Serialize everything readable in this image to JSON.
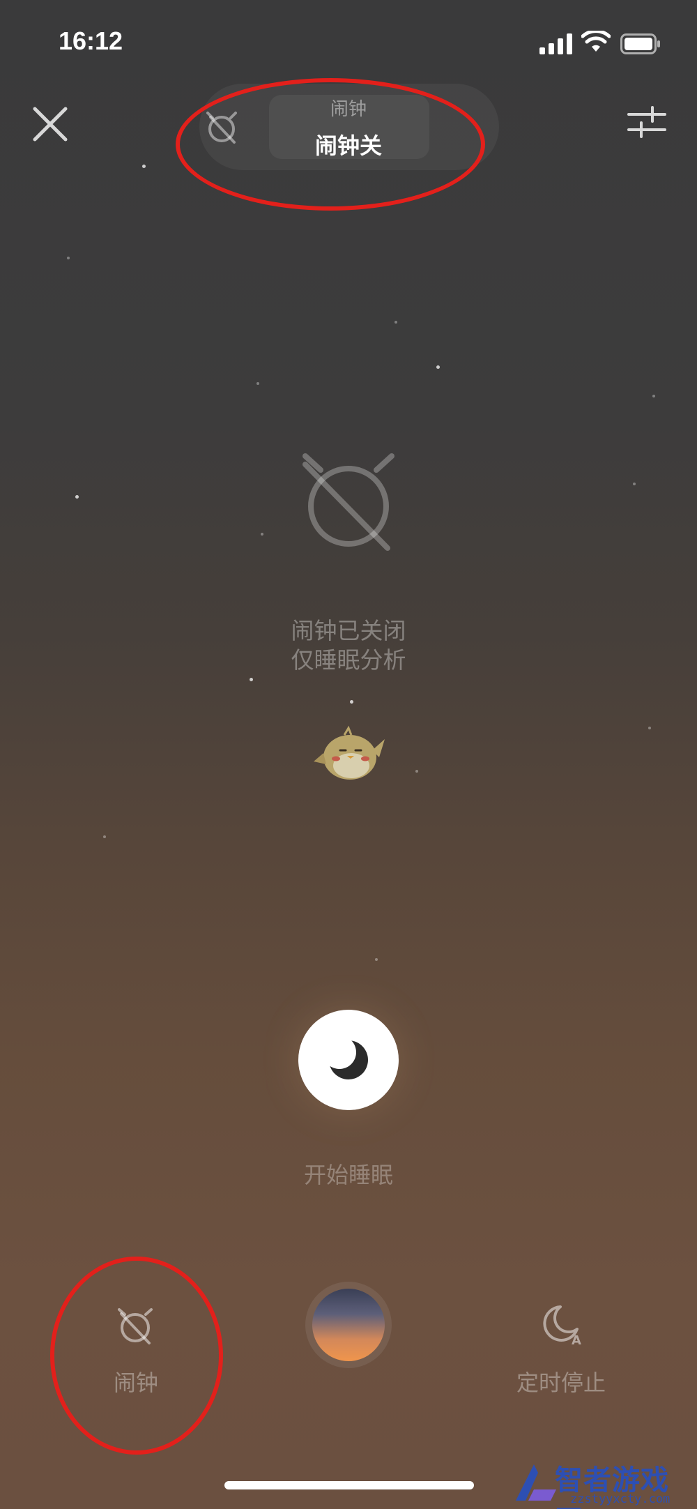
{
  "status_bar": {
    "time": "16:12"
  },
  "header": {
    "mode_subtitle": "闹钟",
    "mode_title": "闹钟关"
  },
  "center": {
    "status_line1": "闹钟已关闭",
    "status_line2": "仅睡眠分析",
    "start_label": "开始睡眠"
  },
  "tabs": {
    "alarm_label": "闹钟",
    "timer_label": "定时停止",
    "timer_icon_badge": "A"
  },
  "icons": {
    "close": "close-icon",
    "settings": "sliders-icon",
    "alarm_off": "alarm-off-icon",
    "moon": "moon-icon",
    "timer": "moon-timer-icon"
  },
  "watermark": {
    "brand": "智者游戏网",
    "url": "zzstyyxcty.com"
  },
  "colors": {
    "annotation": "#e3201b",
    "background_top": "#3a3a3b",
    "background_bottom": "#6b5040",
    "watermark": "#2d4fb3"
  }
}
